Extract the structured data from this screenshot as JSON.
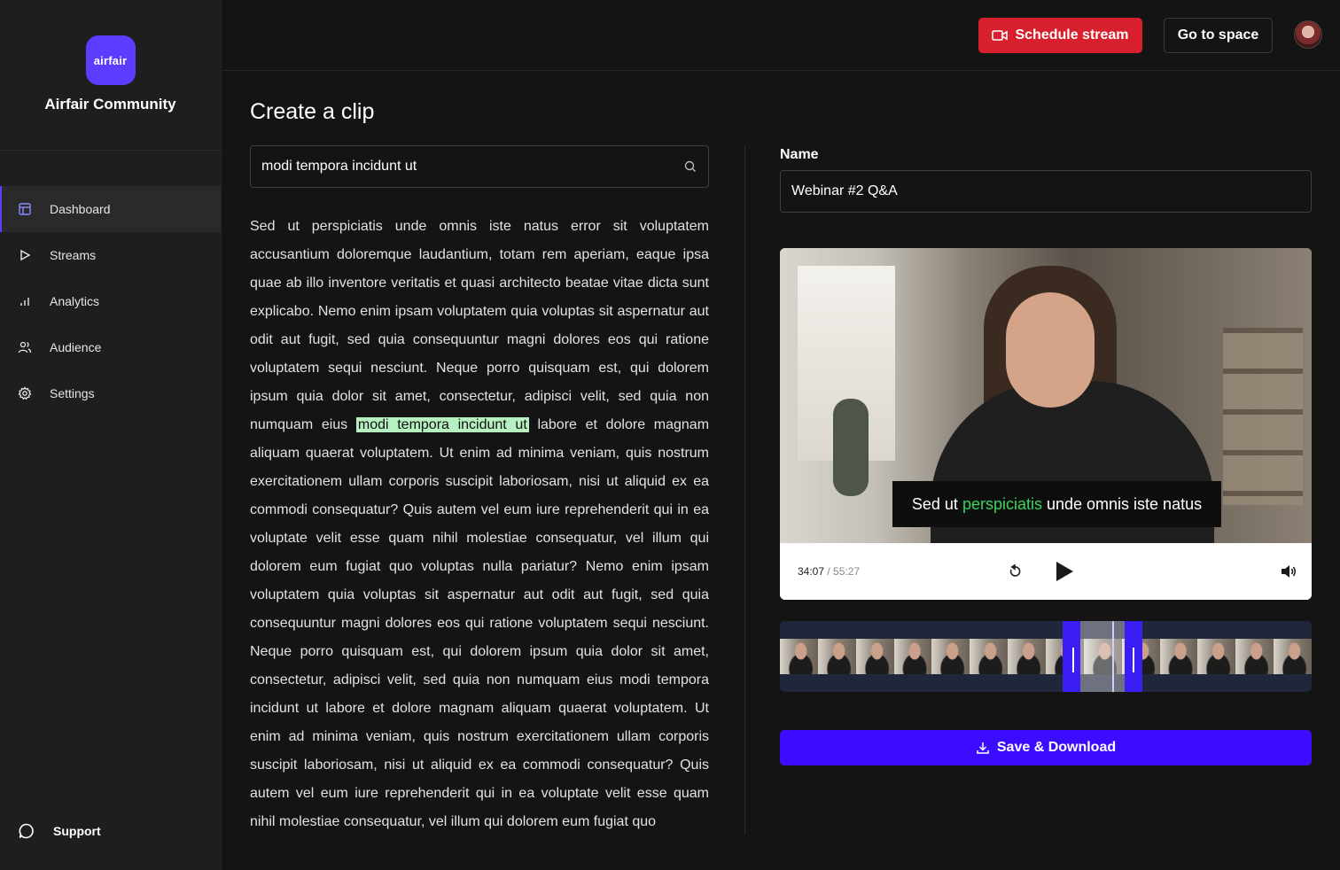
{
  "brand": {
    "logo_text": "airfair",
    "name": "Airfair Community"
  },
  "sidebar": {
    "items": [
      {
        "label": "Dashboard",
        "icon": "dashboard-icon",
        "active": true
      },
      {
        "label": "Streams",
        "icon": "play-icon"
      },
      {
        "label": "Analytics",
        "icon": "bar-chart-icon"
      },
      {
        "label": "Audience",
        "icon": "users-icon"
      },
      {
        "label": "Settings",
        "icon": "gear-icon"
      }
    ],
    "support_label": "Support"
  },
  "header": {
    "schedule_label": "Schedule stream",
    "space_label": "Go to space"
  },
  "main": {
    "title": "Create a clip",
    "search_value": "modi tempora incidunt ut",
    "transcript_before": "Sed ut perspiciatis unde omnis iste natus error sit voluptatem accusantium doloremque laudantium, totam rem aperiam, eaque ipsa quae ab illo inventore veritatis et quasi architecto beatae vitae dicta sunt explicabo. Nemo enim ipsam voluptatem quia voluptas sit aspernatur aut odit aut fugit, sed quia consequuntur magni dolores eos qui ratione voluptatem sequi nesciunt. Neque porro quisquam est, qui dolorem ipsum quia dolor sit amet, consectetur, adipisci velit, sed quia non numquam eius",
    "transcript_highlight": "modi tempora incidunt ut",
    "transcript_after": "labore et dolore magnam aliquam quaerat voluptatem. Ut enim ad minima veniam, quis nostrum exercitationem ullam corporis suscipit laboriosam, nisi ut aliquid ex ea commodi consequatur? Quis autem vel eum iure reprehenderit qui in ea voluptate velit esse quam nihil molestiae consequatur, vel illum qui dolorem eum fugiat quo voluptas nulla pariatur? Nemo enim ipsam voluptatem quia voluptas sit aspernatur aut odit aut fugit, sed quia consequuntur magni dolores eos qui ratione voluptatem sequi nesciunt. Neque porro quisquam est, qui dolorem ipsum quia dolor sit amet, consectetur, adipisci velit, sed quia non numquam eius modi tempora incidunt ut labore et dolore magnam aliquam quaerat voluptatem. Ut enim ad minima veniam, quis nostrum exercitationem ullam corporis suscipit laboriosam, nisi ut aliquid ex ea commodi consequatur? Quis autem vel eum iure reprehenderit qui in ea voluptate velit esse quam nihil molestiae consequatur, vel illum qui dolorem eum fugiat quo"
  },
  "clip": {
    "name_label": "Name",
    "name_value": "Webinar #2 Q&A",
    "caption_before": "Sed ut",
    "caption_highlight": "perspiciatis",
    "caption_after": "unde omnis iste natus",
    "time_current": "34:07",
    "time_separator": " / ",
    "time_total": "55:27",
    "save_label": "Save & Download"
  },
  "colors": {
    "accent": "#3b0cff",
    "brand": "#5a3dff",
    "schedule": "#d81f2d",
    "highlight": "#b6f0c1",
    "caption_green": "#3ad35a"
  }
}
